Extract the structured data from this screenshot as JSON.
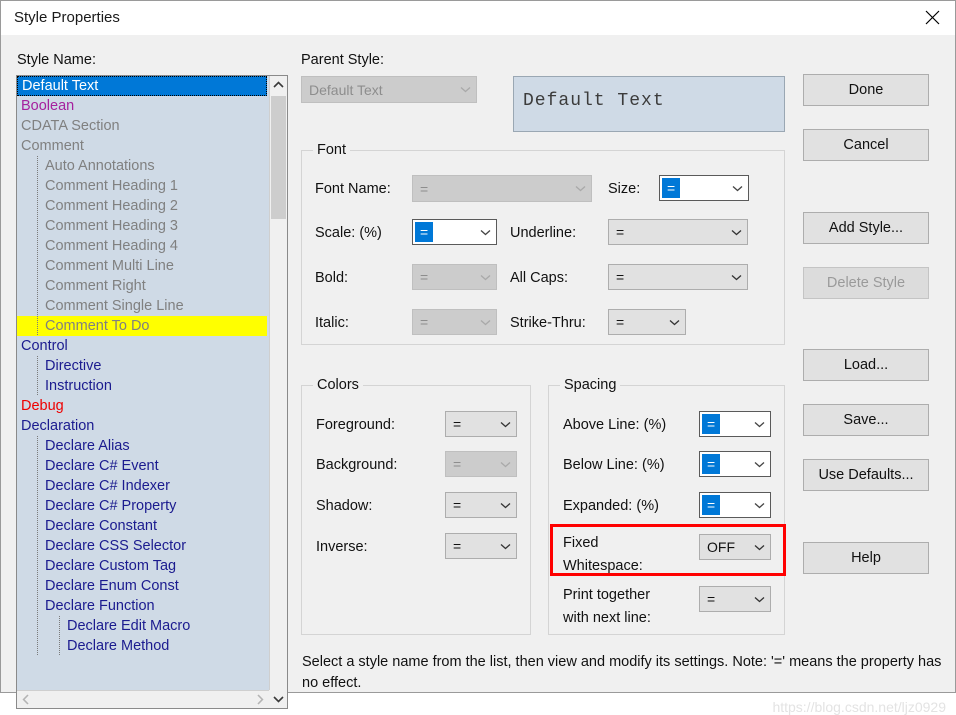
{
  "window": {
    "title": "Style Properties",
    "close_icon": "close-icon"
  },
  "left_panel": {
    "label": "Style Name:",
    "list": [
      {
        "text": "Default Text",
        "level": 0,
        "state": "selected"
      },
      {
        "text": "Boolean",
        "level": 0,
        "state": "magenta"
      },
      {
        "text": "CDATA Section",
        "level": 0,
        "state": "gray"
      },
      {
        "text": "Comment",
        "level": 0,
        "state": "gray"
      },
      {
        "text": "Auto Annotations",
        "level": 1,
        "state": "gray"
      },
      {
        "text": "Comment Heading 1",
        "level": 1,
        "state": "gray"
      },
      {
        "text": "Comment Heading 2",
        "level": 1,
        "state": "gray"
      },
      {
        "text": "Comment Heading 3",
        "level": 1,
        "state": "gray"
      },
      {
        "text": "Comment Heading 4",
        "level": 1,
        "state": "gray"
      },
      {
        "text": "Comment Multi Line",
        "level": 1,
        "state": "gray"
      },
      {
        "text": "Comment Right",
        "level": 1,
        "state": "gray"
      },
      {
        "text": "Comment Single Line",
        "level": 1,
        "state": "gray"
      },
      {
        "text": "Comment To Do",
        "level": 1,
        "state": "yellow"
      },
      {
        "text": "Control",
        "level": 0,
        "state": "navy"
      },
      {
        "text": "Directive",
        "level": 1,
        "state": "navy"
      },
      {
        "text": "Instruction",
        "level": 1,
        "state": "navy"
      },
      {
        "text": "Debug",
        "level": 0,
        "state": "red"
      },
      {
        "text": "Declaration",
        "level": 0,
        "state": "navy"
      },
      {
        "text": "Declare Alias",
        "level": 1,
        "state": "navy"
      },
      {
        "text": "Declare C# Event",
        "level": 1,
        "state": "navy"
      },
      {
        "text": "Declare C# Indexer",
        "level": 1,
        "state": "navy"
      },
      {
        "text": "Declare C# Property",
        "level": 1,
        "state": "navy"
      },
      {
        "text": "Declare Constant",
        "level": 1,
        "state": "navy"
      },
      {
        "text": "Declare CSS Selector",
        "level": 1,
        "state": "navy"
      },
      {
        "text": "Declare Custom Tag",
        "level": 1,
        "state": "navy"
      },
      {
        "text": "Declare Enum Const",
        "level": 1,
        "state": "navy"
      },
      {
        "text": "Declare Function",
        "level": 1,
        "state": "navy"
      },
      {
        "text": "Declare Edit Macro",
        "level": 2,
        "state": "navy"
      },
      {
        "text": "Declare Method",
        "level": 2,
        "state": "navy"
      }
    ],
    "scroll": {
      "up_icon": "chevron-up-icon",
      "down_icon": "chevron-down-icon",
      "left_icon": "chevron-left-icon",
      "right_icon": "chevron-right-icon"
    }
  },
  "parent_style": {
    "label": "Parent Style:",
    "value": "Default Text"
  },
  "preview": {
    "text": "Default Text"
  },
  "font_group": {
    "title": "Font",
    "font_name": {
      "label": "Font Name:",
      "value": "="
    },
    "size": {
      "label": "Size:",
      "value": "="
    },
    "scale": {
      "label": "Scale: (%)",
      "value": "="
    },
    "underline": {
      "label": "Underline:",
      "value": "="
    },
    "bold": {
      "label": "Bold:",
      "value": "="
    },
    "all_caps": {
      "label": "All Caps:",
      "value": "="
    },
    "italic": {
      "label": "Italic:",
      "value": "="
    },
    "strike": {
      "label": "Strike-Thru:",
      "value": "="
    }
  },
  "colors_group": {
    "title": "Colors",
    "foreground": {
      "label": "Foreground:",
      "value": "="
    },
    "background": {
      "label": "Background:",
      "value": "="
    },
    "shadow": {
      "label": "Shadow:",
      "value": "="
    },
    "inverse": {
      "label": "Inverse:",
      "value": "="
    }
  },
  "spacing_group": {
    "title": "Spacing",
    "above_line": {
      "label": "Above Line: (%)",
      "value": "="
    },
    "below_line": {
      "label": "Below Line: (%)",
      "value": "="
    },
    "expanded": {
      "label": "Expanded: (%)",
      "value": "="
    },
    "fixed_whitespace": {
      "label_line1": "Fixed",
      "label_line2": "Whitespace:",
      "value": "OFF"
    },
    "print_together": {
      "label_line1": "Print together",
      "label_line2": "with next line:",
      "value": "="
    }
  },
  "buttons": {
    "done": "Done",
    "cancel": "Cancel",
    "add_style": "Add Style...",
    "delete_style": "Delete Style",
    "load": "Load...",
    "save": "Save...",
    "use_defaults": "Use Defaults...",
    "help": "Help"
  },
  "hint": "Select a style name from the list, then view and modify its settings. Note: '=' means the property has no effect.",
  "watermark": "https://blog.csdn.net/ljz0929",
  "accents": {
    "selection_blue": "#0078d7",
    "highlight_yellow": "#ffff00",
    "annotation_red": "#ff0000",
    "list_bg": "#cfdae6"
  }
}
